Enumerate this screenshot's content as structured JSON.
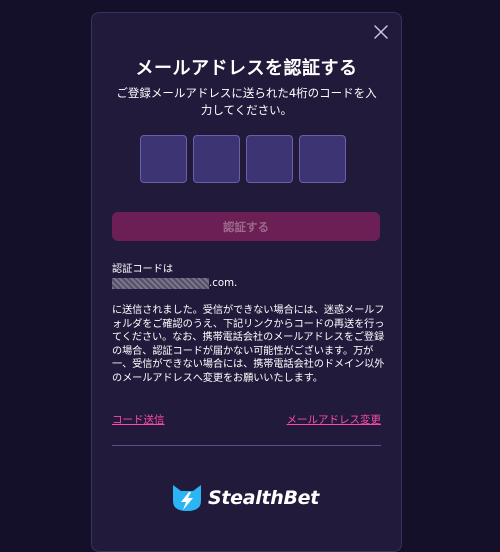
{
  "modal": {
    "close_icon": "close-icon",
    "title": "メールアドレスを認証する",
    "subtitle": "ご登録メールアドレスに送られた4桁のコードを入力してください。",
    "code_inputs": [
      "",
      "",
      "",
      ""
    ],
    "verify_button_label": "認証する",
    "code_prefix": "認証コードは",
    "email_suffix": ".com.",
    "description": "に送信されました。受信ができない場合には、迷惑メールフォルダをご確認のうえ、下記リンクからコードの再送を行ってください。なお、携帯電話会社のメールアドレスをご登録の場合、認証コードが届かない可能性がございます。万が一、受信ができない場合には、携帯電話会社のドメイン以外のメールアドレスへ変更をお願いいたします。",
    "resend_link": "コード送信",
    "change_email_link": "メールアドレス変更",
    "logo_text": "StealthBet",
    "logo_icon": "cat-lightning-icon"
  },
  "colors": {
    "background": "#15102a",
    "modal": "#211a3b",
    "input_fill": "#3d3474",
    "button_fill": "#6b1f55",
    "link": "#ff4aa9",
    "logo_accent": "#2bb5f5"
  }
}
